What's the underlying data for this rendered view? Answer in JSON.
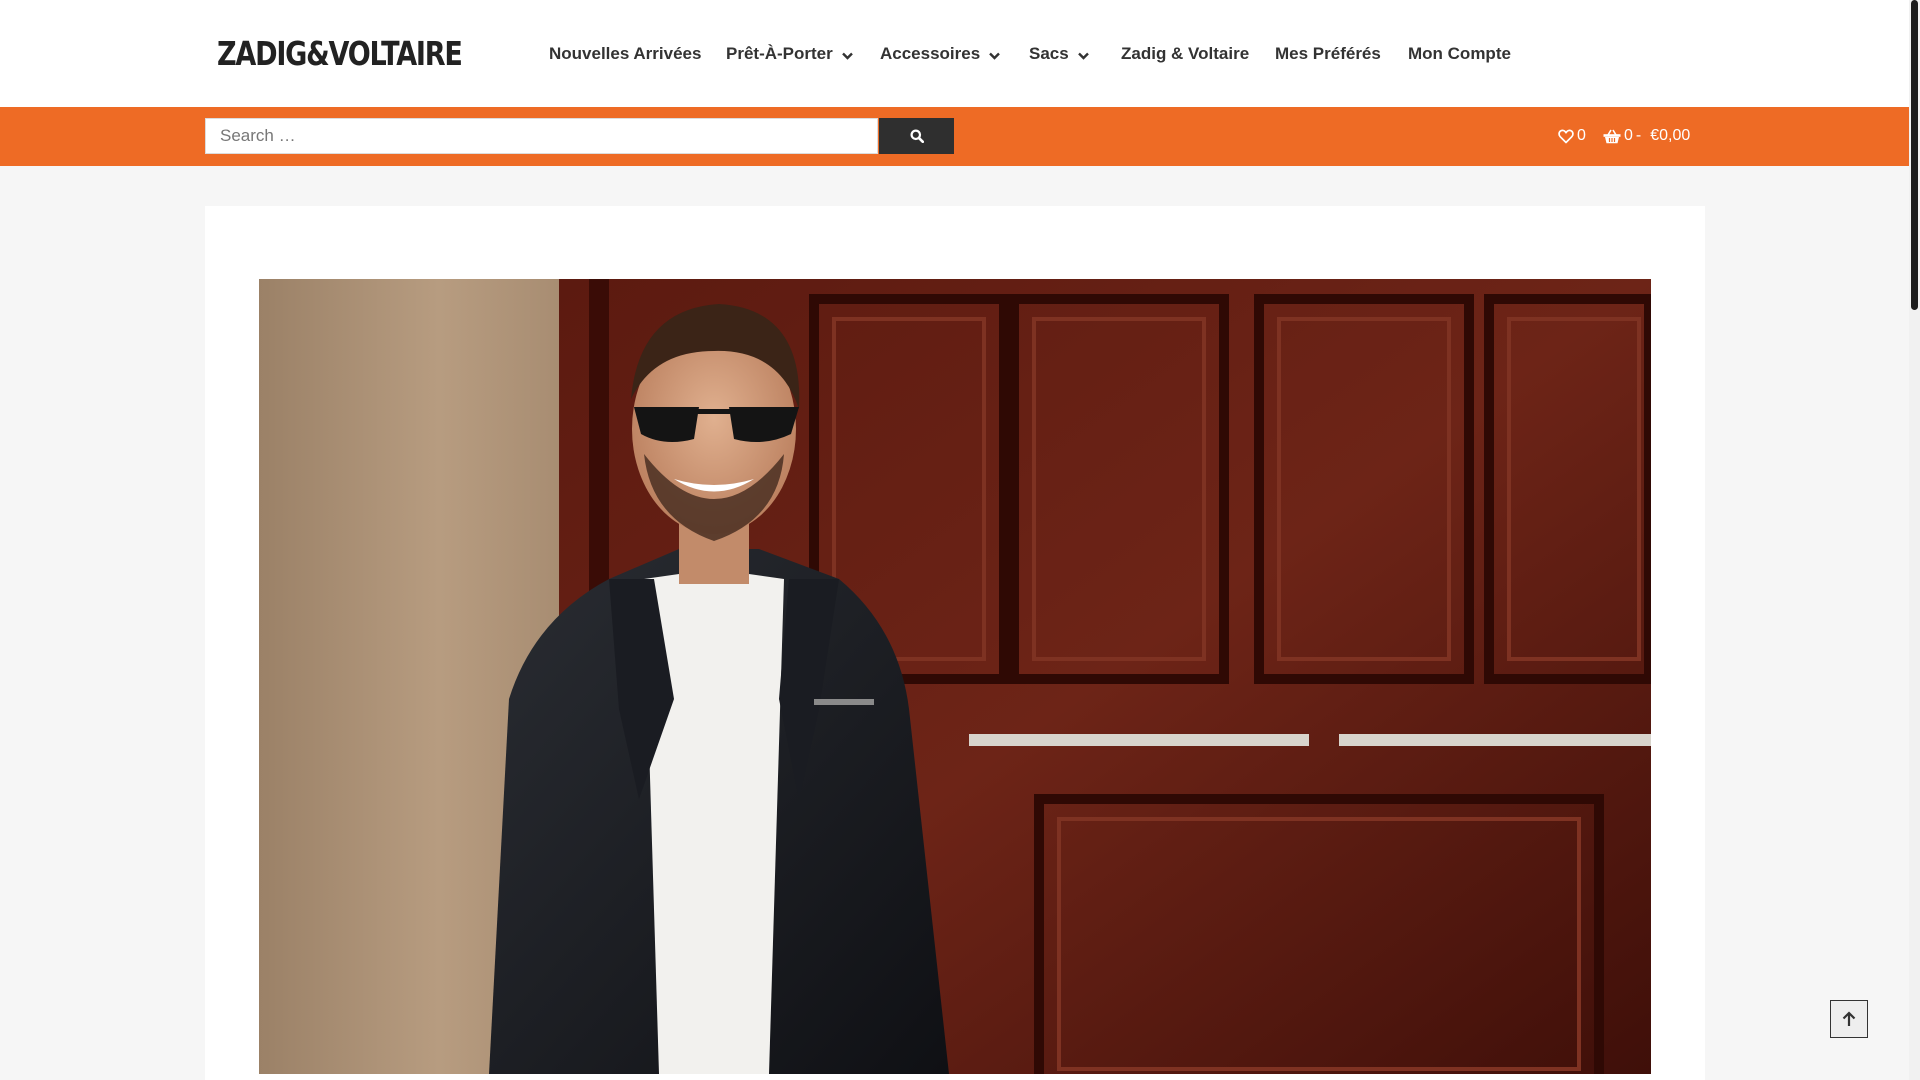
{
  "brand": {
    "logo_text": "ZADIG&VOLTAIRE"
  },
  "nav": {
    "items": [
      {
        "label": "Nouvelles Arrivées",
        "has_dropdown": false
      },
      {
        "label": "Prêt-À-Porter",
        "has_dropdown": true
      },
      {
        "label": "Accessoires",
        "has_dropdown": true
      },
      {
        "label": "Sacs",
        "has_dropdown": true
      },
      {
        "label": "Zadig & Voltaire",
        "has_dropdown": false
      },
      {
        "label": "Mes Préférés",
        "has_dropdown": false
      },
      {
        "label": "Mon Compte",
        "has_dropdown": false
      }
    ]
  },
  "search": {
    "placeholder": "Search …",
    "button_icon": "search-icon"
  },
  "header_right": {
    "wishlist_count": "0",
    "wishlist_icon": "heart-icon",
    "cart_count": "0",
    "cart_separator": "-",
    "cart_total": "€0,00",
    "cart_icon": "basket-icon"
  },
  "hero": {
    "image": "man-in-black-leather-jacket-and-sunglasses-by-wooden-door"
  },
  "colors": {
    "accent": "#ee6b25",
    "search_button": "#2f2f2f",
    "page_bg": "#f6f6f6",
    "nav_text": "#333333"
  },
  "back_to_top": {
    "icon": "arrow-up-icon"
  }
}
